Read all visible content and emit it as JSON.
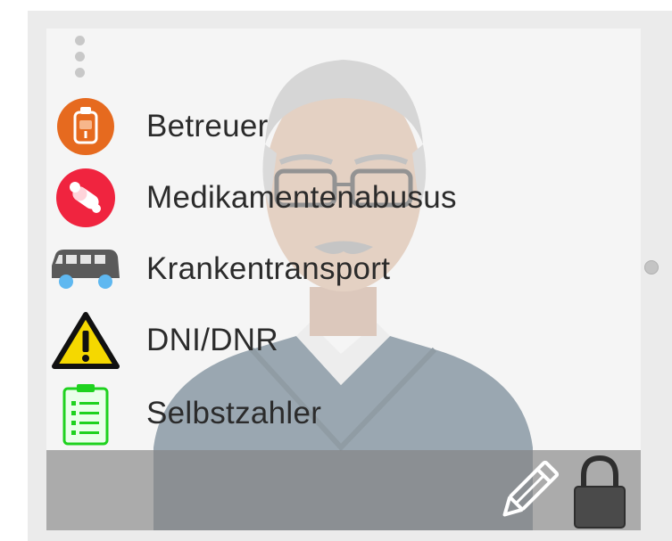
{
  "items": [
    {
      "label": "Betreuer",
      "icon": "caregiver-badge-icon",
      "color": "#e66a1f"
    },
    {
      "label": "Medikamentenabusus",
      "icon": "pill-abuse-icon",
      "color": "#f0243f"
    },
    {
      "label": "Krankentransport",
      "icon": "ambulance-vehicle-icon",
      "color": "#5a5a5a"
    },
    {
      "label": "DNI/DNR",
      "icon": "warning-triangle-icon",
      "color": "#f5d800"
    },
    {
      "label": "Selbstzahler",
      "icon": "checklist-clipboard-icon",
      "color": "#1fd21f"
    }
  ],
  "footer": {
    "edit_icon": "pencil-icon",
    "lock_icon": "lock-icon"
  },
  "colors": {
    "footer_bar": "#8a8a8a",
    "panel_background": "#f5f5f5",
    "text": "#2b2b2b"
  }
}
